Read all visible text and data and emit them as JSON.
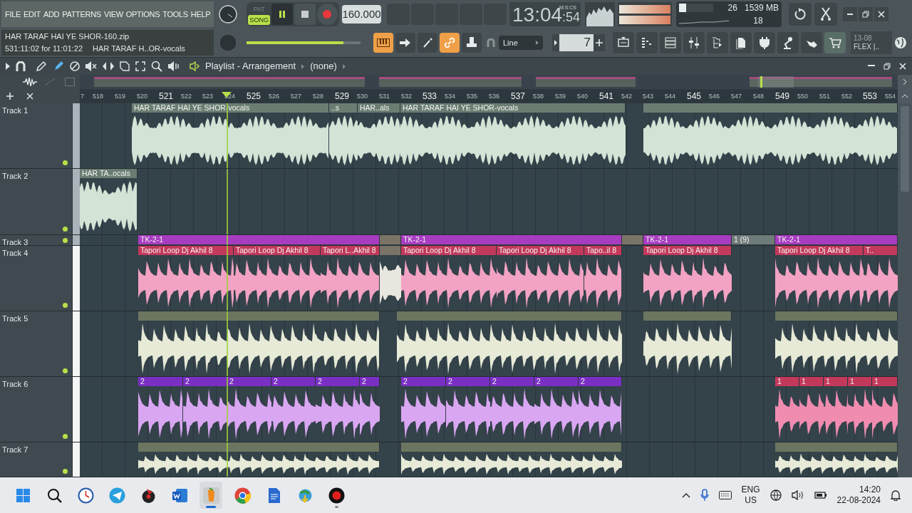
{
  "menu": [
    "FILE",
    "EDIT",
    "ADD",
    "PATTERNS",
    "VIEW",
    "OPTIONS",
    "TOOLS",
    "HELP"
  ],
  "transport": {
    "modes": [
      {
        "label": "PAT",
        "selected": false
      },
      {
        "label": "SONG",
        "selected": true
      }
    ]
  },
  "tempo": "160.000",
  "hint": {
    "file": "HAR TARAF HAI YE SHOR-160.zip",
    "position": "531:11:02 for 11:01:22",
    "clip": "HAR TARAF H..OR-vocals"
  },
  "time": {
    "main": "13:04",
    "small": ":54",
    "unit": "M:S:CS"
  },
  "cpu": {
    "level": 0.2,
    "value": "26",
    "memory": "1539 MB",
    "polyphony": "18"
  },
  "master_volume": {
    "level": 0.85
  },
  "snap": "Line",
  "step": "7",
  "news": {
    "date": "13-08",
    "text": "FLEX |.."
  },
  "playlist": {
    "title": "Playlist - Arrangement",
    "pattern": "(none)",
    "ruler": [
      {
        "label": "7",
        "major": false
      },
      {
        "label": "518",
        "major": false
      },
      {
        "label": "519",
        "major": false
      },
      {
        "label": "520",
        "major": false
      },
      {
        "label": "521",
        "major": true
      },
      {
        "label": "522",
        "major": false
      },
      {
        "label": "523",
        "major": false
      },
      {
        "label": "524",
        "major": false
      },
      {
        "label": "525",
        "major": true
      },
      {
        "label": "526",
        "major": false
      },
      {
        "label": "527",
        "major": false
      },
      {
        "label": "528",
        "major": false
      },
      {
        "label": "529",
        "major": true
      },
      {
        "label": "530",
        "major": false
      },
      {
        "label": "531",
        "major": false
      },
      {
        "label": "532",
        "major": false
      },
      {
        "label": "533",
        "major": true
      },
      {
        "label": "534",
        "major": false
      },
      {
        "label": "535",
        "major": false
      },
      {
        "label": "536",
        "major": false
      },
      {
        "label": "537",
        "major": true
      },
      {
        "label": "538",
        "major": false
      },
      {
        "label": "539",
        "major": false
      },
      {
        "label": "540",
        "major": false
      },
      {
        "label": "541",
        "major": true
      },
      {
        "label": "542",
        "major": false
      },
      {
        "label": "543",
        "major": false
      },
      {
        "label": "544",
        "major": false
      },
      {
        "label": "545",
        "major": true
      },
      {
        "label": "546",
        "major": false
      },
      {
        "label": "547",
        "major": false
      },
      {
        "label": "548",
        "major": false
      },
      {
        "label": "549",
        "major": true
      },
      {
        "label": "550",
        "major": false
      },
      {
        "label": "551",
        "major": false
      },
      {
        "label": "552",
        "major": false
      },
      {
        "label": "553",
        "major": true
      },
      {
        "label": "554",
        "major": false
      }
    ],
    "tracks": [
      {
        "name": "Track 1",
        "enabled": true,
        "clips": [
          {
            "label": "HAR TARAF HAI YE SHOR-vocals",
            "color": "#6b7d72"
          },
          {
            "label": "..s",
            "color": "#6b7d72"
          },
          {
            "label": "HAR..als",
            "color": "#6b7d72"
          },
          {
            "label": "HAR TARAF HAI YE SHOR-vocals",
            "color": "#6b7d72"
          },
          {
            "color": "#6b7d72"
          }
        ]
      },
      {
        "name": "Track 2",
        "enabled": true,
        "clips": [
          {
            "label": "HAR TA..ocals",
            "color": "#6b7d72"
          }
        ]
      },
      {
        "name": "Track 3",
        "enabled": true,
        "clips": [
          {
            "label": "TK-2-1",
            "color": "#a83cc0"
          },
          {
            "color": "#7a7468"
          },
          {
            "label": "TK-2-1",
            "color": "#a83cc0"
          },
          {
            "color": "#7a7468"
          },
          {
            "label": "TK-2-1",
            "color": "#a83cc0"
          },
          {
            "label": "1 (9)",
            "color": "#6f7b78"
          },
          {
            "label": "TK-2-1",
            "color": "#a83cc0"
          }
        ]
      },
      {
        "name": "Track 4",
        "enabled": true,
        "clips": [
          {
            "label": "Tapori Loop Dj Akhil 8",
            "color": "#c2395c"
          },
          {
            "label": "Tapori Loop Dj Akhil 8",
            "color": "#c2395c"
          },
          {
            "label": "Tapori L..Akhil 8",
            "color": "#c2395c"
          },
          {
            "color": "#7a7468"
          },
          {
            "label": "Tapori Loop Dj Akhil 8",
            "color": "#c2395c"
          },
          {
            "label": "Tapori Loop Dj Akhil 8",
            "color": "#c2395c"
          },
          {
            "label": "Tapo..il 8",
            "color": "#c2395c"
          },
          {
            "label": "Tapori Loop Dj Akhil 8",
            "color": "#c2395c"
          },
          {
            "label": "Tapori Loop Dj Akhil 8",
            "color": "#c2395c"
          },
          {
            "label": "T..",
            "color": "#c2395c"
          }
        ]
      },
      {
        "name": "Track 5",
        "enabled": true,
        "clips": [
          {
            "color": "#6b7560"
          },
          {
            "color": "#6b7560"
          },
          {
            "color": "#6b7560"
          },
          {
            "color": "#6b7560"
          }
        ]
      },
      {
        "name": "Track 6",
        "enabled": true,
        "clips": [
          {
            "label": "2",
            "color": "#7a2fc4"
          },
          {
            "label": "2",
            "color": "#7a2fc4"
          },
          {
            "label": "2",
            "color": "#7a2fc4"
          },
          {
            "label": "2",
            "color": "#7a2fc4"
          },
          {
            "label": "2",
            "color": "#7a2fc4"
          },
          {
            "label": "2",
            "color": "#7a2fc4"
          },
          {
            "label": "2",
            "color": "#7a2fc4"
          },
          {
            "label": "2",
            "color": "#7a2fc4"
          },
          {
            "label": "2",
            "color": "#7a2fc4"
          },
          {
            "label": "2",
            "color": "#7a2fc4"
          },
          {
            "label": "2",
            "color": "#7a2fc4"
          },
          {
            "label": "1",
            "color": "#c2395c"
          },
          {
            "label": "1",
            "color": "#c2395c"
          },
          {
            "label": "1",
            "color": "#c2395c"
          },
          {
            "label": "1",
            "color": "#c2395c"
          },
          {
            "label": "1",
            "color": "#c2395c"
          }
        ]
      },
      {
        "name": "Track 7",
        "enabled": true,
        "clips": [
          {
            "color": "#6b7560"
          },
          {
            "color": "#6b7560"
          },
          {
            "color": "#6b7560"
          }
        ]
      }
    ]
  },
  "taskbar": {
    "apps": [
      {
        "kind": "start",
        "running": false
      },
      {
        "kind": "search",
        "running": false
      },
      {
        "kind": "clock",
        "running": false
      },
      {
        "kind": "telegram",
        "running": false
      },
      {
        "kind": "media",
        "running": false
      },
      {
        "kind": "word",
        "running": false
      },
      {
        "kind": "fl",
        "running": true
      },
      {
        "kind": "chrome",
        "running": false
      },
      {
        "kind": "docs",
        "running": false
      },
      {
        "kind": "downloader",
        "running": false
      },
      {
        "kind": "recorder",
        "running": true
      }
    ],
    "language": "ENG",
    "region": "US",
    "clock": "14:20",
    "date": "22-08-2024"
  }
}
